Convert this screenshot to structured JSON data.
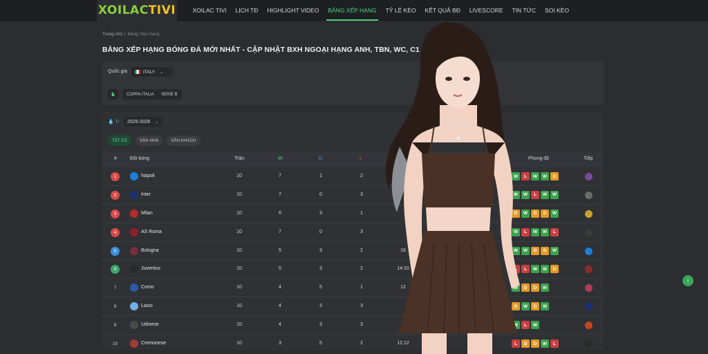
{
  "brand": {
    "logo_part1": "XOILAC",
    "logo_part2": "TIVI"
  },
  "nav": [
    {
      "label": "XOILAC TIVI",
      "active": false
    },
    {
      "label": "LỊCH TĐ",
      "active": false
    },
    {
      "label": "HIGHLIGHT VIDEO",
      "active": false
    },
    {
      "label": "BẢNG XẾP HẠNG",
      "active": true
    },
    {
      "label": "TỶ LỆ KÈO",
      "active": false
    },
    {
      "label": "KẾT QUẢ BĐ",
      "active": false
    },
    {
      "label": "LIVESCORE",
      "active": false
    },
    {
      "label": "TIN TỨC",
      "active": false
    },
    {
      "label": "SOI KÈO",
      "active": false
    }
  ],
  "breadcrumb": {
    "home": "Trang chủ",
    "separator": "/",
    "current": "Bảng Xếp Hạng"
  },
  "page_title": "BẢNG XẾP HẠNG BÓNG ĐÁ MỚI NHẤT - CẬP NHẬT BXH NGOẠI HẠNG ANH, TBN, WC, C1",
  "filters": {
    "country_label": "Quốc gia",
    "country_value": "ITALY",
    "leagues": [
      "COPPA ITALIA",
      "SERIE B"
    ]
  },
  "season": {
    "value": "2025-2026"
  },
  "tabs": [
    {
      "label": "TẤT CẢ",
      "active": true
    },
    {
      "label": "SÂN NHÀ",
      "active": false
    },
    {
      "label": "SÂN KHÁCH",
      "active": false
    }
  ],
  "table_headers": {
    "rank": "#",
    "team": "Đội bóng",
    "played": "Trận",
    "w": "W",
    "d": "D",
    "l": "L",
    "form": "Phong độ",
    "next": "Tiếp"
  },
  "rows": [
    {
      "rank": "1",
      "rank_style": "red",
      "team": "Napoli",
      "crest_color": "#1c7fd6",
      "played": "10",
      "w": "7",
      "d": "1",
      "l": "2",
      "extra": "",
      "form": [
        "W",
        "L",
        "W",
        "W",
        "D"
      ],
      "next_color": "#7b4b9e"
    },
    {
      "rank": "2",
      "rank_style": "red",
      "team": "Inter",
      "crest_color": "#1a2f6f",
      "played": "10",
      "w": "7",
      "d": "0",
      "l": "3",
      "extra": "",
      "form": [
        "W",
        "W",
        "L",
        "W",
        "W"
      ],
      "next_color": "#6b6b6b"
    },
    {
      "rank": "3",
      "rank_style": "red",
      "team": "Milan",
      "crest_color": "#b52a2a",
      "played": "10",
      "w": "6",
      "d": "3",
      "l": "1",
      "extra": "",
      "form": [
        "D",
        "W",
        "D",
        "D",
        "W"
      ],
      "next_color": "#c9a227"
    },
    {
      "rank": "4",
      "rank_style": "red",
      "team": "AS Roma",
      "crest_color": "#8e1f2f",
      "played": "10",
      "w": "7",
      "d": "0",
      "l": "3",
      "extra": "",
      "form": [
        "W",
        "L",
        "W",
        "W",
        "L"
      ],
      "next_color": "#3b3b3b"
    },
    {
      "rank": "5",
      "rank_style": "blue",
      "team": "Bologna",
      "crest_color": "#7a2d3a",
      "played": "10",
      "w": "5",
      "d": "3",
      "l": "2",
      "extra": "16",
      "form": [
        "W",
        "W",
        "D",
        "D",
        "W"
      ],
      "next_color": "#1c7fd6"
    },
    {
      "rank": "6",
      "rank_style": "green",
      "team": "Juventus",
      "crest_color": "#2a2a2a",
      "played": "10",
      "w": "5",
      "d": "3",
      "l": "2",
      "extra": "14:10",
      "form": [
        "L",
        "L",
        "W",
        "W",
        "D"
      ],
      "next_color": "#8a2b2b"
    },
    {
      "rank": "7",
      "rank_style": "plain",
      "team": "Como",
      "crest_color": "#2b5aa8",
      "played": "10",
      "w": "4",
      "d": "5",
      "l": "1",
      "extra": "12",
      "form": [
        "W",
        "D",
        "D",
        "W"
      ],
      "next_color": "#b03a5b"
    },
    {
      "rank": "8",
      "rank_style": "plain",
      "team": "Lazio",
      "crest_color": "#6fb0e6",
      "played": "10",
      "w": "4",
      "d": "3",
      "l": "3",
      "extra": "",
      "form": [
        "D",
        "W",
        "D",
        "W"
      ],
      "next_color": "#1a2f6f"
    },
    {
      "rank": "9",
      "rank_style": "plain",
      "team": "Udinese",
      "crest_color": "#4a4a4a",
      "played": "10",
      "w": "4",
      "d": "3",
      "l": "3",
      "extra": "",
      "form": [
        "W",
        "L",
        "W"
      ],
      "next_color": "#c4451f"
    },
    {
      "rank": "10",
      "rank_style": "plain",
      "team": "Cremonese",
      "crest_color": "#a33a3a",
      "played": "10",
      "w": "3",
      "d": "5",
      "l": "2",
      "extra": "12:12",
      "form": [
        "L",
        "D",
        "D",
        "W",
        "L"
      ],
      "next_color": "#2a2a2a"
    }
  ],
  "colors": {
    "accent": "#4fd184",
    "win": "#3ca24c",
    "loss": "#c94040",
    "draw": "#e59a24"
  }
}
